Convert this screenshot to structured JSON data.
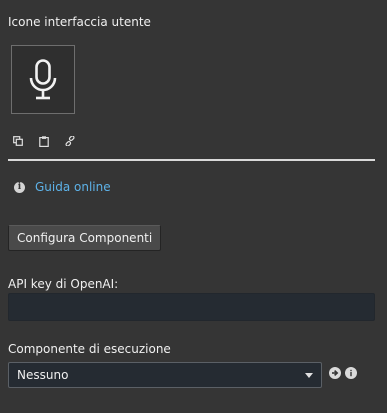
{
  "section": {
    "title": "Icone interfaccia utente",
    "preview_icon": "microphone-icon",
    "actions": [
      {
        "icon": "copy-icon"
      },
      {
        "icon": "clipboard-icon"
      },
      {
        "icon": "link-icon"
      }
    ]
  },
  "help": {
    "icon": "info-icon",
    "link_label": "Guida online",
    "link_color": "#5db2e8"
  },
  "config_button": {
    "label": "Configura Componenti"
  },
  "api_key": {
    "label": "API key di OpenAI:",
    "value": ""
  },
  "component": {
    "label": "Componente di esecuzione",
    "selected": "Nessuno",
    "actions": [
      {
        "icon": "arrow-right-icon"
      },
      {
        "icon": "info-icon"
      }
    ]
  },
  "colors": {
    "background": "#353535",
    "input_background": "#252b32",
    "divider": "#d9d9d9"
  }
}
